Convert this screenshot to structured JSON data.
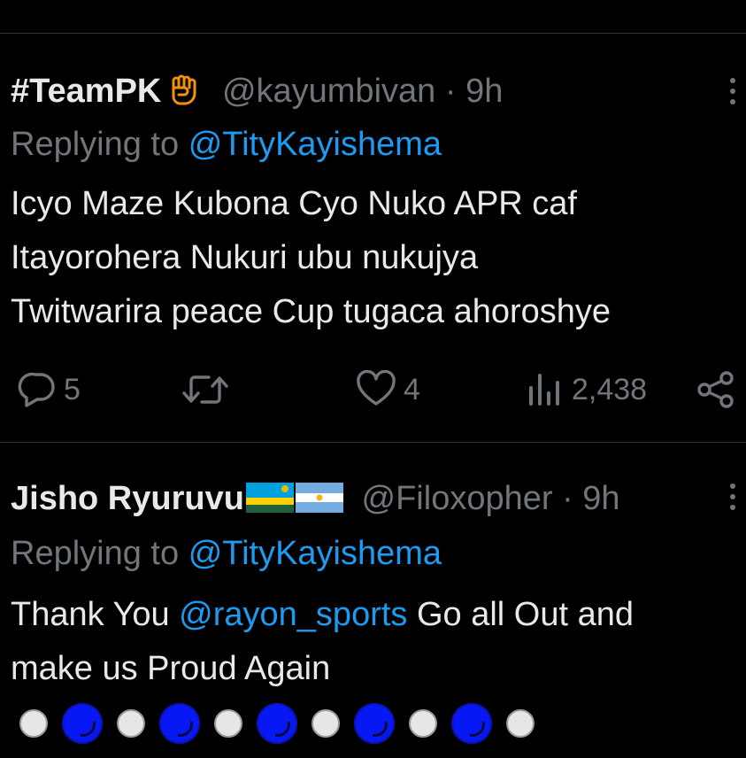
{
  "tweets": [
    {
      "display_name": "#TeamPK",
      "name_emoji": "raised-fist-icon",
      "handle": "@kayumbivan",
      "separator": "·",
      "time": "9h",
      "reply_prefix": "Replying to",
      "reply_to": "@TityKayishema",
      "body_lines": [
        "Icyo Maze Kubona Cyo Nuko APR caf",
        "Itayorohera Nukuri ubu nukujya",
        "Twitwarira peace Cup tugaca ahoroshye"
      ],
      "stats": {
        "replies": "5",
        "retweets": "",
        "likes": "4",
        "views": "2,438"
      }
    },
    {
      "display_name": "Jisho Ryuruvu",
      "name_emojis": [
        "rwanda-flag-icon",
        "argentina-flag-icon"
      ],
      "handle": "@Filoxopher",
      "separator": "·",
      "time": "9h",
      "reply_prefix": "Replying to",
      "reply_to": "@TityKayishema",
      "body_line1_prefix": "Thank You ",
      "body_line1_mention": "@rayon_sports",
      "body_line1_suffix": " Go all Out and",
      "body_line2": "make us Proud Again",
      "emoji_row": [
        "white-circle",
        "blue-circle",
        "white-circle",
        "blue-circle",
        "white-circle",
        "blue-circle",
        "white-circle",
        "blue-circle",
        "white-circle",
        "blue-circle",
        "white-circle"
      ]
    }
  ],
  "colors": {
    "background": "#000000",
    "text": "#e7e9ea",
    "muted": "#71767b",
    "link": "#1d9bf0",
    "divider": "#2f3336"
  }
}
